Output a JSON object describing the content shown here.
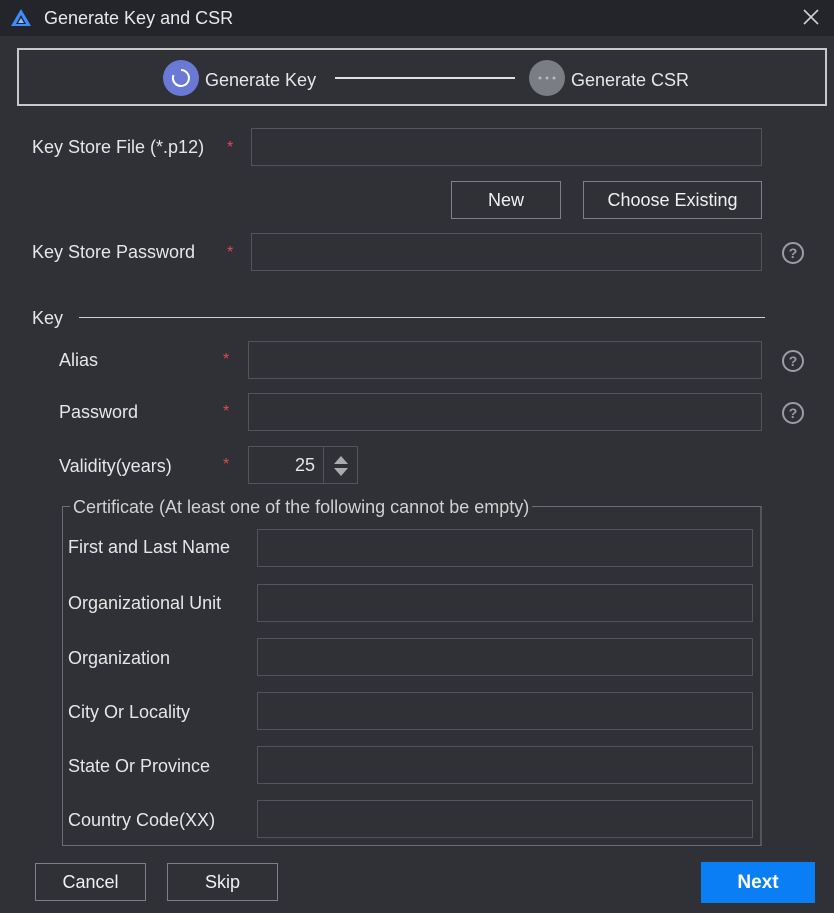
{
  "window": {
    "title": "Generate Key and CSR"
  },
  "steps": {
    "step1_label": "Generate Key",
    "step2_label": "Generate CSR"
  },
  "keystore": {
    "file_label": "Key Store File (*.p12)",
    "file_value": "",
    "new_label": "New",
    "choose_label": "Choose Existing",
    "password_label": "Key Store Password",
    "password_value": ""
  },
  "required_mark": "*",
  "key": {
    "section_label": "Key",
    "alias_label": "Alias",
    "alias_value": "",
    "password_label": "Password",
    "password_value": "",
    "validity_label": "Validity(years)",
    "validity_value": "25"
  },
  "certificate": {
    "legend": "Certificate (At least one of the following cannot be empty)",
    "fields": [
      {
        "label": "First and Last Name",
        "value": ""
      },
      {
        "label": "Organizational Unit",
        "value": ""
      },
      {
        "label": "Organization",
        "value": ""
      },
      {
        "label": "City Or Locality",
        "value": ""
      },
      {
        "label": "State Or Province",
        "value": ""
      },
      {
        "label": "Country Code(XX)",
        "value": ""
      }
    ]
  },
  "footer": {
    "cancel_label": "Cancel",
    "skip_label": "Skip",
    "next_label": "Next"
  },
  "colors": {
    "background": "#2f3136",
    "titlebar": "#23252a",
    "accent": "#0a7ff5",
    "required": "#e5484d",
    "step_active": "#6b79d6",
    "step_inactive": "#7a7d83"
  },
  "icons": {
    "app": "app-logo-icon",
    "close": "close-icon",
    "help": "help-icon",
    "step_active": "refresh-icon",
    "step_pending": "more-dots-icon"
  }
}
